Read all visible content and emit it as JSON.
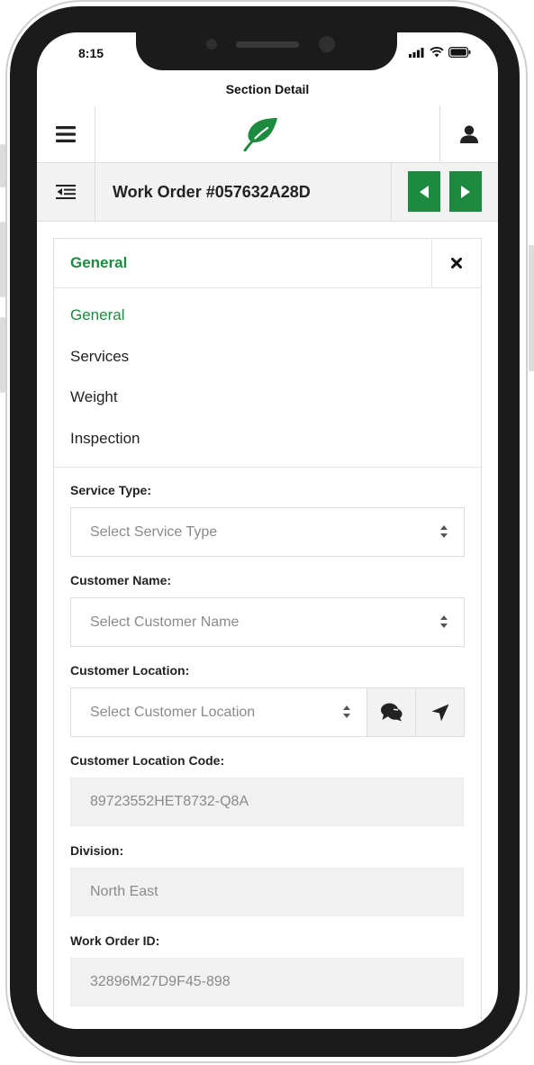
{
  "status_bar": {
    "time": "8:15"
  },
  "title_bar": {
    "title": "Section Detail"
  },
  "header": {
    "menu_icon": "hamburger-icon",
    "logo_icon": "leaf-icon",
    "user_icon": "user-icon",
    "brand_color": "#1d8b3f"
  },
  "work_order_bar": {
    "toggle_icon": "indent-icon",
    "title": "Work Order #057632A28D",
    "prev_icon": "caret-left-icon",
    "next_icon": "caret-right-icon"
  },
  "panel": {
    "title": "General",
    "close_icon": "close-icon",
    "sections": [
      {
        "label": "General",
        "active": true
      },
      {
        "label": "Services",
        "active": false
      },
      {
        "label": "Weight",
        "active": false
      },
      {
        "label": "Inspection",
        "active": false
      }
    ]
  },
  "form": {
    "service_type": {
      "label": "Service Type:",
      "value": "Select Service Type"
    },
    "customer_name": {
      "label": "Customer Name:",
      "value": "Select Customer Name"
    },
    "customer_location": {
      "label": "Customer Location:",
      "value": "Select Customer Location",
      "chat_icon": "comments-icon",
      "send_icon": "location-arrow-icon"
    },
    "customer_location_code": {
      "label": "Customer Location Code:",
      "value": "89723552HET8732-Q8A"
    },
    "division": {
      "label": "Division:",
      "value": "North East"
    },
    "work_order_id": {
      "label": "Work Order ID:",
      "value": "32896M27D9F45-898"
    }
  }
}
